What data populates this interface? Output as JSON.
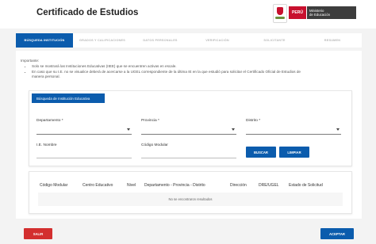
{
  "header": {
    "title": "Certificado de Estudios",
    "logo_peru": "PERÚ",
    "logo_ministry_line1": "Ministerio",
    "logo_ministry_line2": "de Educación"
  },
  "stepper": {
    "steps": [
      {
        "label": "BÚSQUEDA INSTITUCIÓN"
      },
      {
        "label": "GRADOS Y CALIFICACIONES"
      },
      {
        "label": "DATOS PERSONALES"
      },
      {
        "label": "VERIFICACIÓN"
      },
      {
        "label": "SOLICITANTE"
      },
      {
        "label": "RESUMEN"
      }
    ]
  },
  "notice": {
    "title": "Importante:",
    "items": [
      "Solo se mostrará las Instituciones Educativas (IIEE) que se encuentren activas en escale.",
      "En caso que su I.E. no se visualice deberá de acercarse a la UGEL correspondiente de la última IE en la que estudió para solicitar el Certificado Oficial de Estudios de",
      "manera personal."
    ]
  },
  "search_panel": {
    "title": "Búsqueda de Institución Educativa",
    "departamento_label": "Departamento *",
    "provincia_label": "Provincia *",
    "distrito_label": "Distrito *",
    "ie_nombre_label": "I.E. Nombre",
    "codigo_modular_label": "Código Modular",
    "buscar_label": "BUSCAR",
    "limpiar_label": "LIMPIAR"
  },
  "results_table": {
    "columns": [
      "Código Modular",
      "Centro Educativo",
      "Nivel",
      "Departamento - Provincia - Distrito",
      "Dirección",
      "DRE/UGEL",
      "Estado de Solicitud"
    ],
    "empty_message": "No se encontraron resultados"
  },
  "footer": {
    "salir_label": "SALIR",
    "aceptar_label": "ACEPTAR"
  },
  "colors": {
    "primary": "#0b5cad",
    "danger": "#d32f2f",
    "brand_red": "#c8102e"
  }
}
